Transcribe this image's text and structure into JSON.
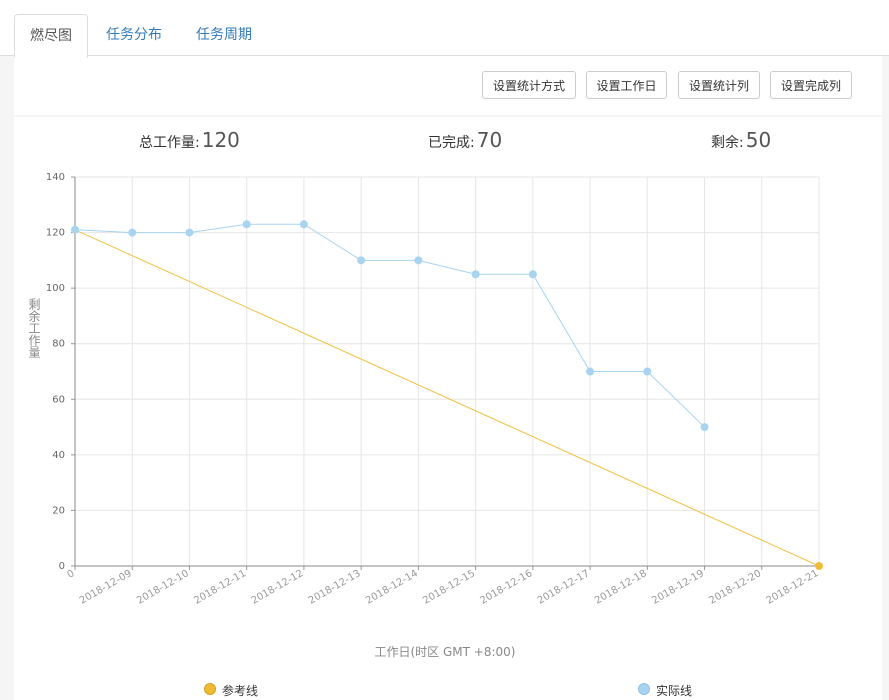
{
  "tabs": [
    {
      "label": "燃尽图",
      "active": true
    },
    {
      "label": "任务分布",
      "active": false
    },
    {
      "label": "任务周期",
      "active": false
    }
  ],
  "toolbar": {
    "buttons": [
      "设置统计方式",
      "设置工作日",
      "设置统计列",
      "设置完成列"
    ]
  },
  "stats": {
    "total_label": "总工作量:",
    "total_value": "120",
    "done_label": "已完成:",
    "done_value": "70",
    "remain_label": "剩余:",
    "remain_value": "50"
  },
  "colors": {
    "reference_line": "#f0c040",
    "reference_fill": "#eebb33",
    "actual_line": "#a8d4f0",
    "actual_fill": "#a8d4f0",
    "tab_link": "#337ab7"
  },
  "chart_data": {
    "type": "line",
    "xlabel": "工作日(时区 GMT +8:00)",
    "ylabel": "剩余工作量",
    "ylim": [
      0,
      140
    ],
    "yticks": [
      0,
      20,
      40,
      60,
      80,
      100,
      120,
      140
    ],
    "categories": [
      "0",
      "2018-12-09",
      "2018-12-10",
      "2018-12-11",
      "2018-12-12",
      "2018-12-13",
      "2018-12-14",
      "2018-12-15",
      "2018-12-16",
      "2018-12-17",
      "2018-12-18",
      "2018-12-19",
      "2018-12-20",
      "2018-12-21"
    ],
    "grid": true,
    "legend_position": "bottom",
    "series": [
      {
        "name": "参考线",
        "points": [
          [
            0,
            121
          ],
          [
            13,
            0
          ]
        ]
      },
      {
        "name": "实际线",
        "points": [
          [
            0,
            121
          ],
          [
            1,
            120
          ],
          [
            2,
            120
          ],
          [
            3,
            123
          ],
          [
            4,
            123
          ],
          [
            5,
            110
          ],
          [
            6,
            110
          ],
          [
            7,
            105
          ],
          [
            8,
            105
          ],
          [
            9,
            70
          ],
          [
            10,
            70
          ],
          [
            11,
            50
          ]
        ]
      }
    ]
  }
}
